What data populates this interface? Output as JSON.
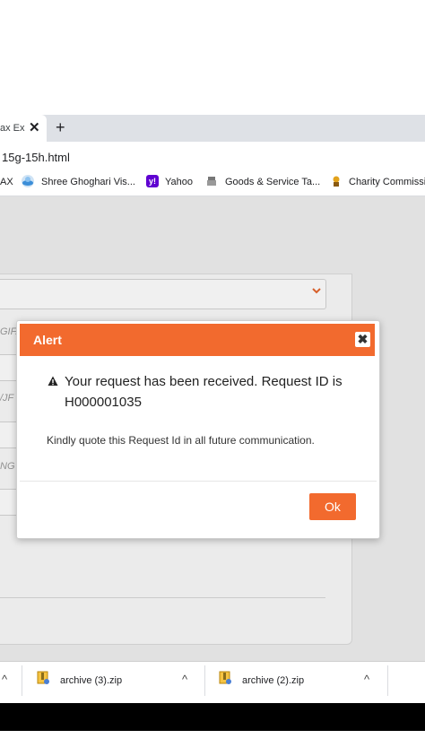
{
  "browser": {
    "tab_title": "ax Ex",
    "tab_close_label": "✕",
    "new_tab_label": "+",
    "url": "15g-15h.html",
    "bookmarks": [
      {
        "label": "AX",
        "icon": "none"
      },
      {
        "label": "Shree Ghoghari Vis...",
        "icon": "globe-icon"
      },
      {
        "label": "Yahoo",
        "icon": "yahoo-icon"
      },
      {
        "label": "Goods & Service Ta...",
        "icon": "emblem-icon"
      },
      {
        "label": "Charity Commissio",
        "icon": "charity-icon"
      }
    ]
  },
  "page": {
    "ghost_labels": [
      "GIF.",
      "/JF",
      "NG"
    ]
  },
  "dialog": {
    "title": "Alert",
    "close_label": "✖",
    "message": "Your request has been received. Request ID is H000001035",
    "note": "Kindly quote this Request Id in all future communication.",
    "ok_label": "Ok",
    "accent_color": "#f26a2e"
  },
  "downloads": {
    "items": [
      {
        "name": "archive (3).zip",
        "icon": "zip-file-icon"
      },
      {
        "name": "archive (2).zip",
        "icon": "zip-file-icon"
      }
    ],
    "chevron_label": "^"
  }
}
